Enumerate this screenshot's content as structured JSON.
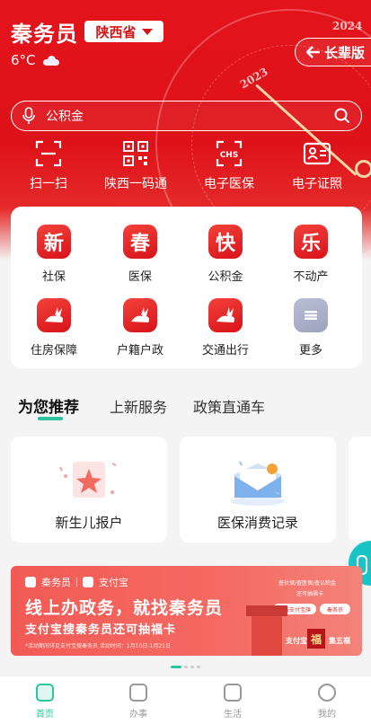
{
  "header": {
    "app_title": "秦务员",
    "province": "陕西省",
    "temperature": "6°C",
    "weather_icon": "cloud-icon",
    "elder_mode_label": "长辈版",
    "deco_year_top": "2024",
    "deco_year_arc": "2023"
  },
  "search": {
    "placeholder": "公积金"
  },
  "quick_actions": [
    {
      "label": "扫一扫",
      "icon": "scan-icon"
    },
    {
      "label": "陕西一码通",
      "icon": "qr-code-icon"
    },
    {
      "label": "电子医保",
      "icon": "medical-insurance-icon"
    },
    {
      "label": "电子证照",
      "icon": "id-card-icon"
    }
  ],
  "services": [
    {
      "label": "社保",
      "glyph": "新"
    },
    {
      "label": "医保",
      "glyph": "春"
    },
    {
      "label": "公积金",
      "glyph": "快"
    },
    {
      "label": "不动产",
      "glyph": "乐"
    },
    {
      "label": "住房保障",
      "glyph": "rabbit"
    },
    {
      "label": "户籍户政",
      "glyph": "rabbit"
    },
    {
      "label": "交通出行",
      "glyph": "rabbit"
    },
    {
      "label": "更多",
      "glyph": "≡"
    }
  ],
  "tabs": [
    {
      "label": "为您推荐",
      "active": true
    },
    {
      "label": "上新服务",
      "active": false
    },
    {
      "label": "政策直通车",
      "active": false
    }
  ],
  "recommendations": [
    {
      "label": "新生儿报户",
      "icon": "newborn-icon"
    },
    {
      "label": "医保消费记录",
      "icon": "mail-record-icon"
    }
  ],
  "banner": {
    "logo_left": "秦务员",
    "logo_right": "支付宝",
    "headline": "线上办政务，就找秦务员",
    "subline": "支付宝搜秦务员还可抽福卡",
    "note": "*活动期间详见支付宝搜秦务员 活动时间：1月10日-1月21日",
    "right_line1": "查社保/查医保/查公积金",
    "right_line2": "还可抽福卡",
    "pill_left": "上线支付宝旗",
    "pill_right": "秦务员",
    "bottom_left": "支付宝",
    "fu_char": "福",
    "bottom_right": "集五福"
  },
  "bottom_nav": [
    {
      "label": "首页",
      "active": true
    },
    {
      "label": "办事",
      "active": false
    },
    {
      "label": "生活",
      "active": false
    },
    {
      "label": "我的",
      "active": false
    }
  ],
  "colors": {
    "brand_red": "#e3131b",
    "accent_green": "#2ec4a0",
    "float_cyan": "#19c3c6"
  }
}
